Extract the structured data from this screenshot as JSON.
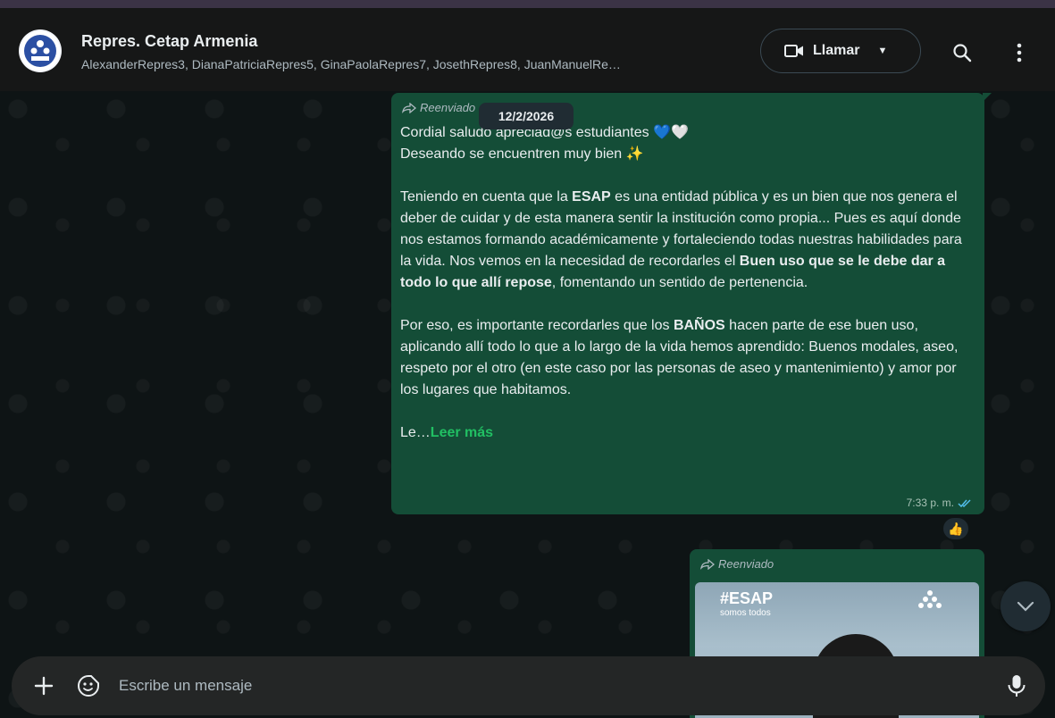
{
  "header": {
    "title": "Repres. Cetap Armenia",
    "members": "AlexanderRepres3, DianaPatriciaRepres5, GinaPaolaRepres7, JosethRepres8, JuanManuelRe…",
    "call_label": "Llamar",
    "icons": {
      "video": "video-camera-icon",
      "dropdown": "chevron-down-icon",
      "search": "search-icon",
      "menu": "kebab-menu-icon"
    }
  },
  "date_chip": "12/2/2026",
  "message1": {
    "forwarded_label": "Reenviado",
    "lines": {
      "l1": "Cordial saludo apreciad@s estudiantes 💙🤍",
      "l2": "Deseando se encuentren muy bien ✨",
      "p2_a": "Teniendo en cuenta que la ",
      "p2_b": "ESAP",
      "p2_c": " es una entidad pública y es un bien que nos genera el deber de cuidar y de esta manera sentir la institución como propia... Pues es aquí donde nos estamos formando académicamente y fortaleciendo todas nuestras habilidades para la vida. Nos vemos en la necesidad de recordarles el ",
      "p2_d": "Buen uso que se le debe dar a todo lo que allí repose",
      "p2_e": ", fomentando un sentido de pertenencia.",
      "p3_a": "Por eso, es importante recordarles que los ",
      "p3_b": "BAÑOS",
      "p3_c": " hacen parte de ese buen uso, aplicando allí todo lo que a lo largo de la vida hemos aprendido: Buenos modales, aseo, respeto por el otro (en este caso por las personas de aseo y mantenimiento) y amor por los lugares que habitamos.",
      "p4_a": "Le…",
      "read_more": "Leer más"
    },
    "time": "7:33 p. m.",
    "reaction": "👍"
  },
  "message2": {
    "forwarded_label": "Reenviado",
    "media_tag": "#ESAP",
    "media_subtag": "somos todos"
  },
  "composer": {
    "placeholder": "Escribe un mensaje"
  },
  "colors": {
    "bubble": "#144d37",
    "header": "#161717",
    "accent": "#21c063",
    "background": "#0e1415"
  }
}
